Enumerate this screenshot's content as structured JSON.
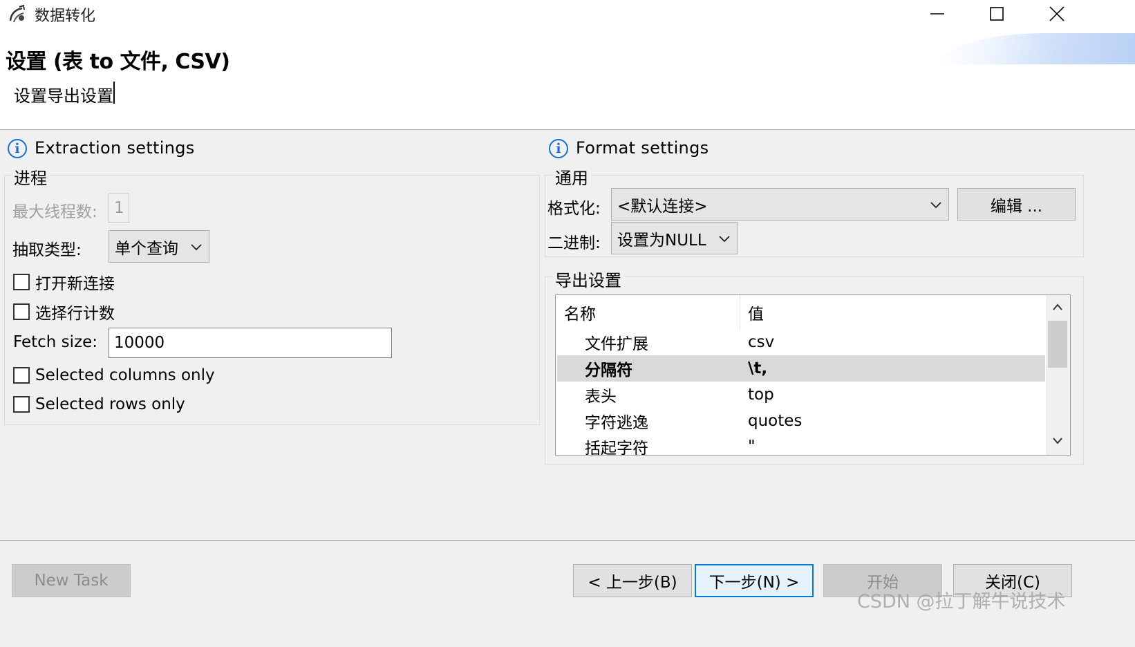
{
  "window": {
    "title": "数据转化",
    "controls": [
      "minimize-icon",
      "maximize-icon",
      "close-icon"
    ]
  },
  "header": {
    "title": "设置 (表 to 文件, CSV)",
    "subtitle": "设置导出设置"
  },
  "extraction": {
    "heading": "Extraction settings",
    "group_title": "进程",
    "max_threads_label": "最大线程数:",
    "max_threads_value": "1",
    "extract_type_label": "抽取类型:",
    "extract_type_value": "单个查询",
    "open_new_connection": {
      "label": "打开新连接",
      "checked": false
    },
    "select_row_count": {
      "label": "选择行计数",
      "checked": false
    },
    "fetch_size_label": "Fetch size:",
    "fetch_size_value": "10000",
    "selected_columns_only": {
      "label": "Selected columns only",
      "checked": false
    },
    "selected_rows_only": {
      "label": "Selected rows only",
      "checked": false
    }
  },
  "format": {
    "heading": "Format settings",
    "general_group_title": "通用",
    "formatter_label": "格式化:",
    "formatter_value": "<默认连接>",
    "edit_button": "编辑 ...",
    "binary_label": "二进制:",
    "binary_value": "设置为NULL",
    "export_group_title": "导出设置",
    "table": {
      "columns": [
        "名称",
        "值"
      ],
      "rows": [
        {
          "name": "文件扩展",
          "value": "csv",
          "selected": false
        },
        {
          "name": "分隔符",
          "value": "\\t,",
          "selected": true
        },
        {
          "name": "表头",
          "value": "top",
          "selected": false
        },
        {
          "name": "字符逃逸",
          "value": "quotes",
          "selected": false
        },
        {
          "name": "括起字符",
          "value": "\"",
          "selected": false
        }
      ]
    }
  },
  "footer": {
    "new_task": "New Task",
    "back": "< 上一步(B)",
    "next": "下一步(N) >",
    "start": "开始",
    "close": "关闭(C)"
  },
  "watermark": "CSDN @拉丁解牛说技术",
  "colors": {
    "info_blue": "#1a6fd6",
    "default_button_border": "#0078d7",
    "selected_row": "#d9d9d9"
  }
}
